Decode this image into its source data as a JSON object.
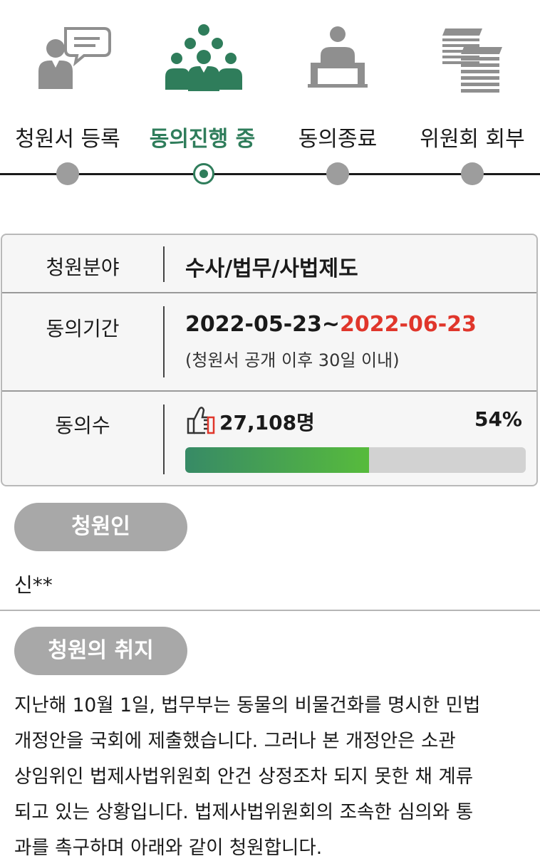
{
  "steps": [
    {
      "label": "청원서 등록",
      "icon": "petition-register-icon",
      "active": false
    },
    {
      "label": "동의진행 중",
      "icon": "people-group-icon",
      "active": true
    },
    {
      "label": "동의종료",
      "icon": "podium-icon",
      "active": false
    },
    {
      "label": "위원회 회부",
      "icon": "document-stack-icon",
      "active": false
    }
  ],
  "info": {
    "category_label": "청원분야",
    "category_value": "수사/법무/사법제도",
    "period_label": "동의기간",
    "period_start": "2022-05-23~",
    "period_end": "2022-06-23",
    "period_note": "(청원서 공개 이후 30일 이내)",
    "count_label": "동의수",
    "count_value": "27,108명",
    "percent_text": "54%",
    "percent": 54
  },
  "petitioner": {
    "pill": "청원인",
    "name": "신**"
  },
  "purpose": {
    "pill": "청원의 취지",
    "lines": [
      "지난해 10월 1일, 법무부는 동물의 비물건화를 명시한 민법",
      "개정안을 국회에 제출했습니다. 그러나 본 개정안은 소관",
      "상임위인 법제사법위원회 안건 상정조차 되지 못한 채 계류",
      "되고 있는 상황입니다. 법제사법위원회의 조속한 심의와 통",
      "과를 촉구하며 아래와 같이 청원합니다."
    ]
  },
  "colors": {
    "accent": "#2f7d5b",
    "deadline": "#e0362b",
    "inactive": "#9d9d9d",
    "progress_start": "#378a66",
    "progress_end": "#57bb3c"
  }
}
